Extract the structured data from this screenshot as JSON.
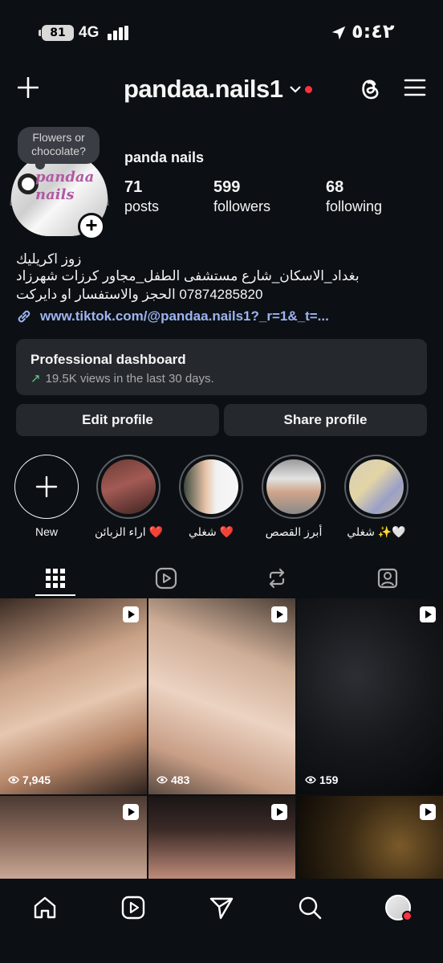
{
  "status_bar": {
    "battery": "81",
    "network": "4G",
    "time": "٥:٤٢"
  },
  "header": {
    "username": "pandaa.nails1"
  },
  "note": {
    "text": "Flowers or chocolate?"
  },
  "avatar": {
    "logo_text": "pandaa nails"
  },
  "profile": {
    "display_name": "panda nails",
    "stats": [
      {
        "value": "71",
        "label": "posts"
      },
      {
        "value": "599",
        "label": "followers"
      },
      {
        "value": "68",
        "label": "following"
      }
    ],
    "bio": [
      "زوز اكريليك",
      "بغداد_الاسكان_شارع مستشفى الطفل_مجاور كرزات شهرزاد",
      "07874285820 الحجز والاستفسار او دايركت"
    ],
    "link": "www.tiktok.com/@pandaa.nails1?_r=1&_t=..."
  },
  "dashboard": {
    "title": "Professional dashboard",
    "subtitle": "19.5K views in the last 30 days."
  },
  "buttons": {
    "edit": "Edit profile",
    "share": "Share profile"
  },
  "highlights": [
    {
      "label": "New"
    },
    {
      "label": "اراء الزبائن ❤️"
    },
    {
      "label": "شغلي ❤️"
    },
    {
      "label": "أبرز القصص"
    },
    {
      "label": "شغلي ✨🤍"
    }
  ],
  "grid": [
    {
      "views": "7,945"
    },
    {
      "views": "483"
    },
    {
      "views": "159"
    },
    {
      "views": ""
    },
    {
      "views": ""
    },
    {
      "views": ""
    }
  ],
  "colors": {
    "background": "#0c1014",
    "card": "#25292e",
    "link": "#9cb4f0",
    "notification": "#ff3040",
    "trend": "#5bd18b"
  }
}
